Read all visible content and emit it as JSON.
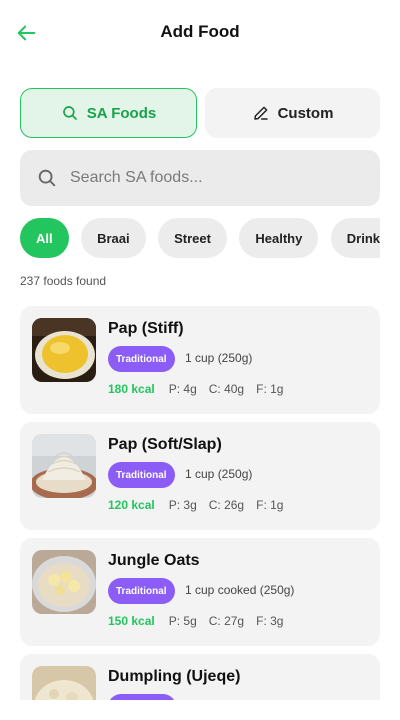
{
  "header": {
    "title": "Add Food",
    "back_icon": "arrow-left-icon",
    "accent": "#22c55e"
  },
  "source_tabs": [
    {
      "label": "SA Foods",
      "icon": "search-icon",
      "active": true
    },
    {
      "label": "Custom",
      "icon": "pencil-icon",
      "active": false
    }
  ],
  "search": {
    "placeholder": "Search SA foods...",
    "value": ""
  },
  "filters": [
    {
      "label": "All",
      "active": true
    },
    {
      "label": "Braai",
      "active": false
    },
    {
      "label": "Street",
      "active": false
    },
    {
      "label": "Healthy",
      "active": false
    },
    {
      "label": "Drinks",
      "active": false
    }
  ],
  "results_count": "237 foods found",
  "foods": [
    {
      "name": "Pap (Stiff)",
      "tag": "Traditional",
      "serving": "1 cup (250g)",
      "kcal": "180 kcal",
      "protein": "P: 4g",
      "carbs": "C: 40g",
      "fat": "F: 1g"
    },
    {
      "name": "Pap (Soft/Slap)",
      "tag": "Traditional",
      "serving": "1 cup (250g)",
      "kcal": "120 kcal",
      "protein": "P: 3g",
      "carbs": "C: 26g",
      "fat": "F: 1g"
    },
    {
      "name": "Jungle Oats",
      "tag": "Traditional",
      "serving": "1 cup cooked (250g)",
      "kcal": "150 kcal",
      "protein": "P: 5g",
      "carbs": "C: 27g",
      "fat": "F: 3g"
    },
    {
      "name": "Dumpling (Ujeqe)",
      "tag": "Traditional",
      "serving": "",
      "kcal": "",
      "protein": "",
      "carbs": "",
      "fat": ""
    }
  ],
  "colors": {
    "accent": "#22c55e",
    "tag": "#8b5cf6",
    "card": "#f3f3f3"
  }
}
